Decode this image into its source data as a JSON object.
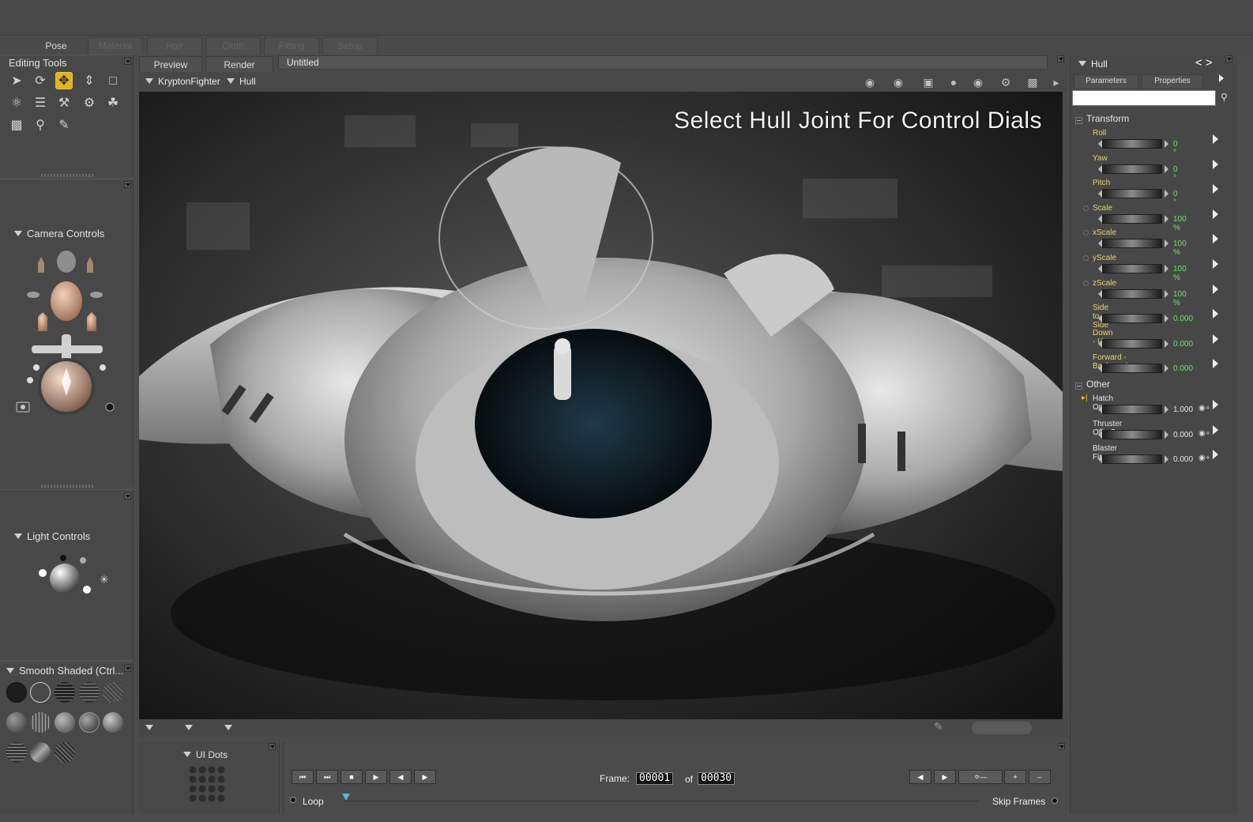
{
  "rooms": [
    "Pose",
    "Material",
    "Hair",
    "Cloth",
    "Fitting",
    "Setup"
  ],
  "editing_tools": {
    "title": "Editing Tools"
  },
  "camera_controls": {
    "title": "Camera Controls"
  },
  "light_controls": {
    "title": "Light Controls"
  },
  "display_styles": {
    "title": "Smooth Shaded (Ctrl..."
  },
  "ui_dots": {
    "title": "UI Dots"
  },
  "document": {
    "tabs": [
      "Preview",
      "Render"
    ],
    "title": "Untitled",
    "figure": "KryptonFighter",
    "actor": "Hull",
    "hint": "Select Hull Joint For Control Dials"
  },
  "timeline": {
    "frame_label": "Frame:",
    "current_frame": "00001",
    "of_label": "of",
    "total_frames": "00030",
    "loop_label": "Loop",
    "skip_label": "Skip Frames"
  },
  "parameters": {
    "actor": "Hull",
    "nav": "< >",
    "tabs": [
      "Parameters",
      "Properties"
    ],
    "groups": [
      {
        "name": "Transform",
        "params": [
          {
            "name": "Roll",
            "value": "0 °"
          },
          {
            "name": "Yaw",
            "value": "0 °"
          },
          {
            "name": "Pitch",
            "value": "0 °"
          },
          {
            "name": "Scale",
            "value": "100 %"
          },
          {
            "name": "xScale",
            "value": "100 %"
          },
          {
            "name": "yScale",
            "value": "100 %"
          },
          {
            "name": "zScale",
            "value": "100 %"
          },
          {
            "name": "Side to Side",
            "value": "0.000"
          },
          {
            "name": "Down - Up",
            "value": "0.000"
          },
          {
            "name": "Forward - Backward",
            "value": "0.000"
          }
        ]
      },
      {
        "name": "Other",
        "params": [
          {
            "name": "Hatch Open",
            "value": "1.000"
          },
          {
            "name": "Thruster Off - On",
            "value": "0.000"
          },
          {
            "name": "Blaster Fire",
            "value": "0.000"
          }
        ]
      }
    ]
  },
  "colors": {
    "accent": "#e2b51a",
    "param_name": "#e3d46d",
    "param_value": "#6de26d"
  }
}
